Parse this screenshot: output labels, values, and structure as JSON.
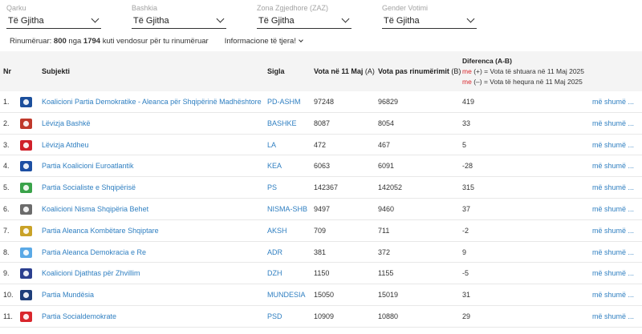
{
  "filters": [
    {
      "label": "Qarku",
      "value": "Të Gjitha"
    },
    {
      "label": "Bashkia",
      "value": "Të Gjitha"
    },
    {
      "label": "Zona Zgjedhore (ZAZ)",
      "value": "Të Gjitha"
    },
    {
      "label": "Gender Votimi",
      "value": "Të Gjitha"
    }
  ],
  "summary": {
    "prefix": "Rinumëruar:",
    "count": "800",
    "mid": "nga",
    "total": "1794",
    "suffix": "kuti vendosur për tu rinumëruar",
    "more_info": "Informacione të tjera!"
  },
  "header": {
    "nr": "Nr",
    "subjekti": "Subjekti",
    "sigla": "Sigla",
    "vota_11": "Vota në 11 Maj",
    "vota_11_tag": "(A)",
    "vota_pas": "Vota pas rinumërimit",
    "vota_pas_tag": "(B)",
    "diferenca": "Diferenca",
    "diferenca_tag": "(A-B)",
    "plus_me": "me",
    "plus_text": "(+) = Vota të shtuara në 11 Maj 2025",
    "minus_me": "me",
    "minus_text": "(–) = Vota të hequra në 11 Maj 2025"
  },
  "more_label": "më shumë ...",
  "rows": [
    {
      "nr": "1.",
      "name": "Koalicioni Partia Demokratike - Aleanca për Shqipërinë Madhështore",
      "sigla": "PD-ASHM",
      "a": "97248",
      "b": "96829",
      "diff": "419",
      "logo": "pd-logo-icon",
      "color": "#1c4f9c"
    },
    {
      "nr": "2.",
      "name": "Lëvizja Bashkë",
      "sigla": "BASHKE",
      "a": "8087",
      "b": "8054",
      "diff": "33",
      "logo": "bashke-logo-icon",
      "color": "#c0392b"
    },
    {
      "nr": "3.",
      "name": "Lëvizja Atdheu",
      "sigla": "LA",
      "a": "472",
      "b": "467",
      "diff": "5",
      "logo": "atdheu-logo-icon",
      "color": "#d0202a"
    },
    {
      "nr": "4.",
      "name": "Partia Koalicioni Euroatlantik",
      "sigla": "KEA",
      "a": "6063",
      "b": "6091",
      "diff": "-28",
      "logo": "kea-logo-icon",
      "color": "#1d4fa3"
    },
    {
      "nr": "5.",
      "name": "Partia Socialiste e Shqipërisë",
      "sigla": "PS",
      "a": "142367",
      "b": "142052",
      "diff": "315",
      "logo": "ps-logo-icon",
      "color": "#3aa34a"
    },
    {
      "nr": "6.",
      "name": "Koalicioni Nisma Shqipëria Behet",
      "sigla": "NISMA-SHB",
      "a": "9497",
      "b": "9460",
      "diff": "37",
      "logo": "nisma-logo-icon",
      "color": "#6b6b6b"
    },
    {
      "nr": "7.",
      "name": "Partia Aleanca Kombëtare Shqiptare",
      "sigla": "AKSH",
      "a": "709",
      "b": "711",
      "diff": "-2",
      "logo": "aksh-logo-icon",
      "color": "#c9a227"
    },
    {
      "nr": "8.",
      "name": "Partia Aleanca Demokracia e Re",
      "sigla": "ADR",
      "a": "381",
      "b": "372",
      "diff": "9",
      "logo": "adr-logo-icon",
      "color": "#5aa9e6"
    },
    {
      "nr": "9.",
      "name": "Koalicioni Djathtas për Zhvillim",
      "sigla": "DZH",
      "a": "1150",
      "b": "1155",
      "diff": "-5",
      "logo": "dzh-logo-icon",
      "color": "#2b3f8f"
    },
    {
      "nr": "10.",
      "name": "Partia Mundësia",
      "sigla": "MUNDESIA",
      "a": "15050",
      "b": "15019",
      "diff": "31",
      "logo": "mundesia-logo-icon",
      "color": "#1e3e7a"
    },
    {
      "nr": "11.",
      "name": "Partia Socialdemokrate",
      "sigla": "PSD",
      "a": "10909",
      "b": "10880",
      "diff": "29",
      "logo": "psd-logo-icon",
      "color": "#d9262c"
    }
  ]
}
